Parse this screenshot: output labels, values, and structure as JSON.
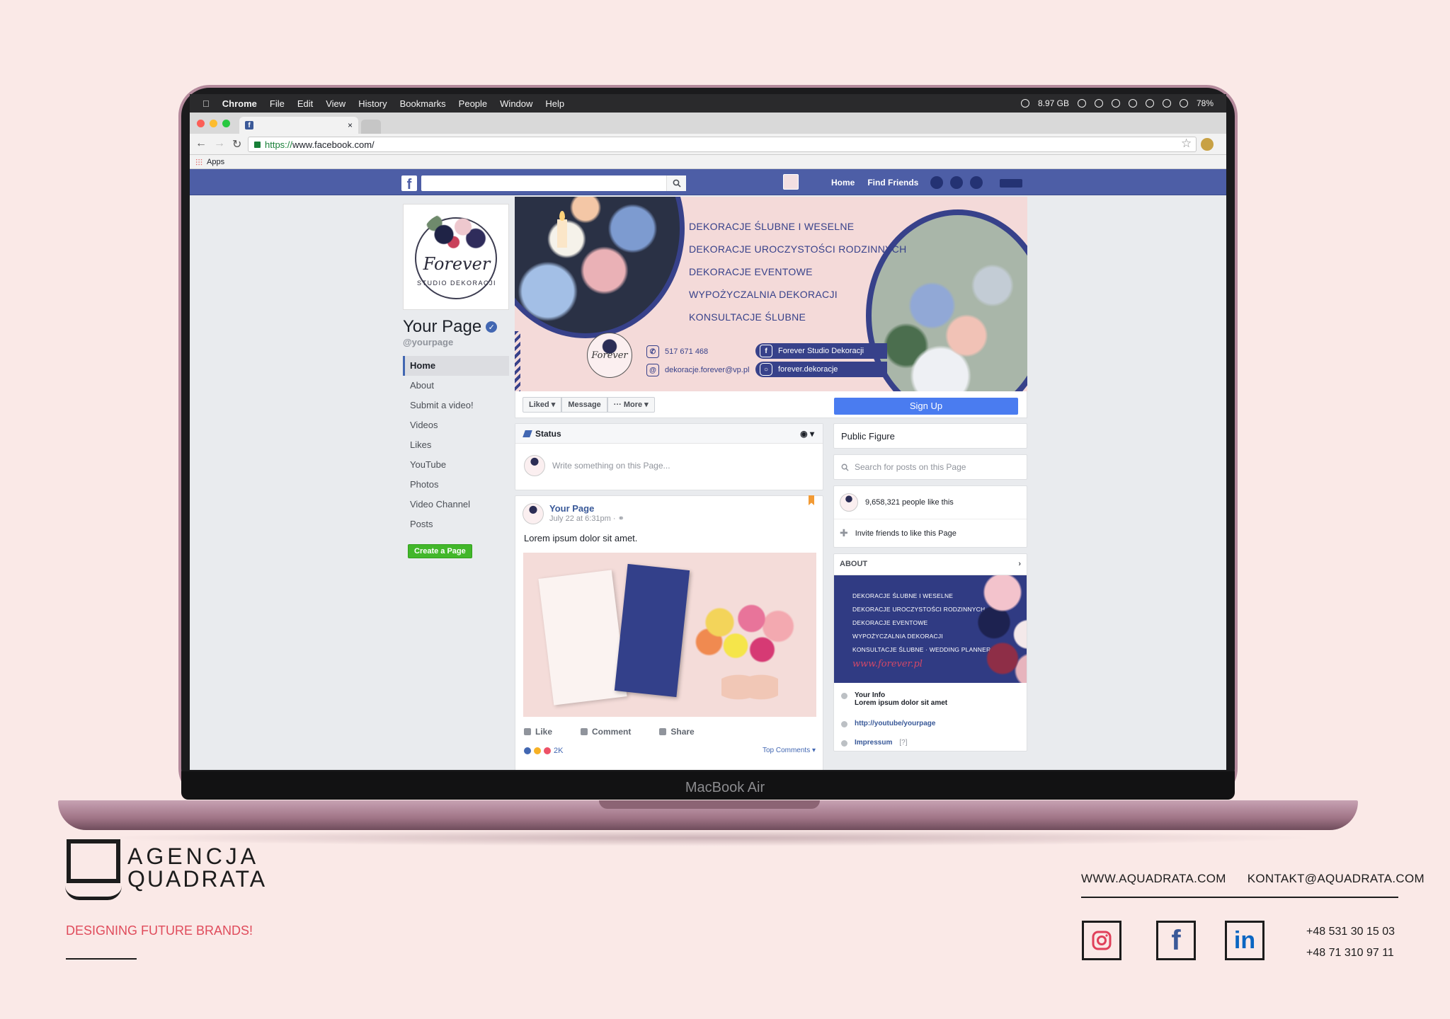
{
  "menubar": {
    "app": "Chrome",
    "items": [
      "File",
      "Edit",
      "View",
      "History",
      "Bookmarks",
      "People",
      "Window",
      "Help"
    ],
    "memory": "8.97 GB",
    "battery": "78%"
  },
  "browser": {
    "url_scheme": "https://",
    "url_rest": "www.facebook.com/",
    "bookmark_apps": "Apps",
    "tab_close": "×"
  },
  "fb": {
    "logo": "f",
    "nav": [
      "Home",
      "Find Friends"
    ]
  },
  "page": {
    "profile_script": "Forever",
    "profile_sub": "STUDIO DEKORACJI",
    "name": "Your Page",
    "verified_mark": "✓",
    "handle": "@yourpage",
    "nav": [
      "Home",
      "About",
      "Submit a video!",
      "Videos",
      "Likes",
      "YouTube",
      "Photos",
      "Video Channel",
      "Posts"
    ],
    "create_button": "Create a Page"
  },
  "cover": {
    "services": [
      "DEKORACJE ŚLUBNE I WESELNE",
      "DEKORACJE UROCZYSTOŚCI RODZINNYCH",
      "DEKORACJE EVENTOWE",
      "WYPOŻYCZALNIA DEKORACJI",
      "KONSULTACJE ŚLUBNE"
    ],
    "logo_script": "Forever",
    "phone": "517 671 468",
    "email": "dekoracje.forever@vp.pl",
    "facebook": "Forever Studio Dekoracji",
    "instagram": "forever.dekoracje"
  },
  "actions": {
    "liked": "Liked ▾",
    "message": "Message",
    "more": "··· More ▾",
    "signup": "Sign Up"
  },
  "composer": {
    "label": "Status",
    "placeholder": "Write something on this Page..."
  },
  "post": {
    "author": "Your Page",
    "date": "July 22 at 6:31pm · ",
    "text": "Lorem ipsum dolor sit amet.",
    "like": "Like",
    "comment": "Comment",
    "share": "Share",
    "reaction_count": "2K",
    "top_comments": "Top Comments ▾"
  },
  "sidebar": {
    "category": "Public Figure",
    "search_placeholder": "Search for posts on this Page",
    "likes": "9,658,321 people like this",
    "invite": "Invite friends to like this Page",
    "about_title": "ABOUT",
    "about_services": [
      "DEKORACJE ŚLUBNE I WESELNE",
      "DEKORACJE UROCZYSTOŚCI RODZINNYCH",
      "DEKORACJE EVENTOWE",
      "WYPOŻYCZALNIA DEKORACJI",
      "KONSULTACJE ŚLUBNE · WEDDING PLANNER"
    ],
    "about_signature": "www.forever.pl",
    "info_label": "Your Info",
    "info_text": "Lorem ipsum dolor sit amet",
    "youtube": "http://youtube/yourpage",
    "impressum": "Impressum",
    "impressum_q": "[?]"
  },
  "device": {
    "label": "MacBook Air"
  },
  "agency": {
    "name_line1": "AGENCJA",
    "name_line2": "QUADRATA",
    "tagline": "DESIGNING FUTURE BRANDS!",
    "website": "WWW.AQUADRATA.COM",
    "email": "KONTAKT@AQUADRATA.COM",
    "phone1": "+48 531 30 15 03",
    "phone2": "+48 71 310 97 11",
    "social": {
      "facebook": "f",
      "linkedin": "in"
    }
  },
  "colors": {
    "fb_blue": "#4d5ea6",
    "accent_navy": "#37418a",
    "background": "#fae9e7",
    "tagline_red": "#e04b5b"
  }
}
